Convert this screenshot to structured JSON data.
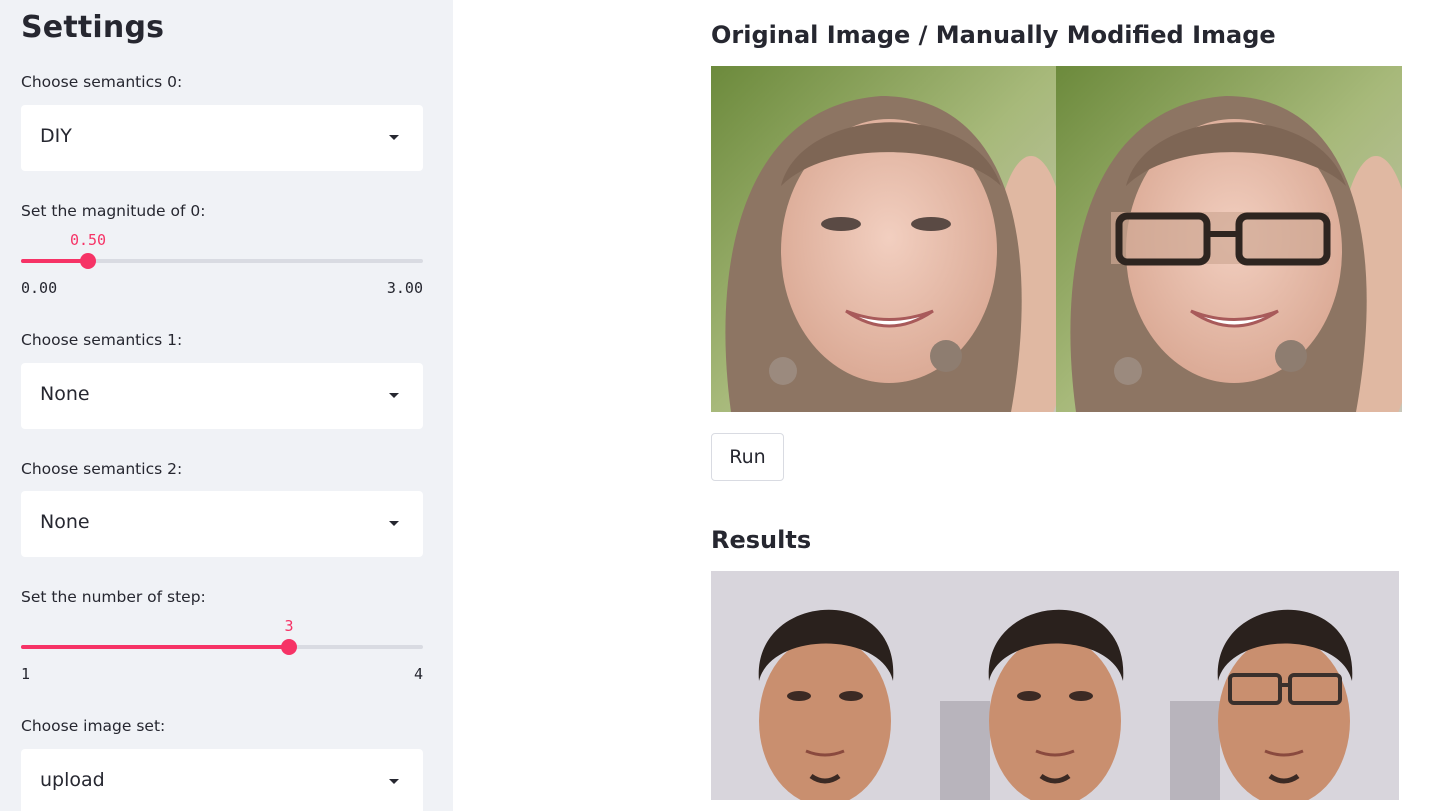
{
  "sidebar": {
    "title": "Settings",
    "semantics0": {
      "label": "Choose semantics 0:",
      "value": "DIY"
    },
    "magnitude": {
      "label": "Set the magnitude of 0:",
      "value_text": "0.50",
      "min_text": "0.00",
      "max_text": "3.00",
      "value": 0.5,
      "min": 0,
      "max": 3
    },
    "semantics1": {
      "label": "Choose semantics 1:",
      "value": "None"
    },
    "semantics2": {
      "label": "Choose semantics 2:",
      "value": "None"
    },
    "steps": {
      "label": "Set the number of step:",
      "value_text": "3",
      "min_text": "1",
      "max_text": "4",
      "value": 3,
      "min": 1,
      "max": 4
    },
    "image_set": {
      "label": "Choose image set:",
      "value": "upload"
    }
  },
  "main": {
    "original_title": "Original Image / Manually Modified Image",
    "run_label": "Run",
    "results_title": "Results"
  },
  "colors": {
    "accent": "#f63366",
    "sidebar_bg": "#f0f2f6",
    "text": "#262730"
  }
}
